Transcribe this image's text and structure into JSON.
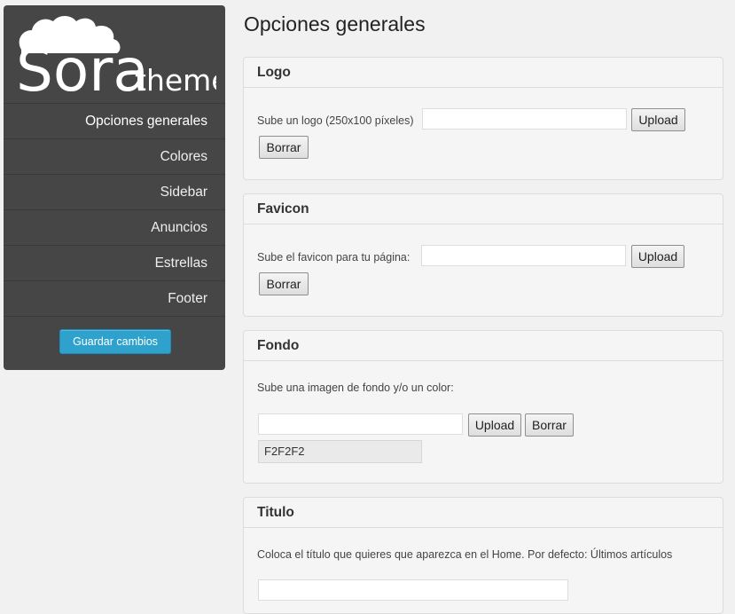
{
  "sidebar": {
    "logo_main": "Sora",
    "logo_sub": "theme",
    "items": [
      {
        "label": "Opciones generales"
      },
      {
        "label": "Colores"
      },
      {
        "label": "Sidebar"
      },
      {
        "label": "Anuncios"
      },
      {
        "label": "Estrellas"
      },
      {
        "label": "Footer"
      }
    ],
    "save_label": "Guardar cambios"
  },
  "page_title": "Opciones generales",
  "sections": {
    "logo": {
      "title": "Logo",
      "label": "Sube un logo (250x100 píxeles)",
      "value": "",
      "upload_label": "Upload",
      "delete_label": "Borrar"
    },
    "favicon": {
      "title": "Favicon",
      "label": "Sube el favicon para tu página:",
      "value": "",
      "upload_label": "Upload",
      "delete_label": "Borrar"
    },
    "fondo": {
      "title": "Fondo",
      "label": "Sube una imagen de fondo y/o un color:",
      "value": "",
      "upload_label": "Upload",
      "delete_label": "Borrar",
      "color_value": "F2F2F2"
    },
    "titulo": {
      "title": "Titulo",
      "label": "Coloca el título que quieres que aparezca en el Home. Por defecto: Últimos artículos",
      "value": ""
    }
  },
  "colors": {
    "sidebar_bg": "#464646",
    "accent": "#2ea2cc",
    "page_bg": "#f1f1f1"
  }
}
